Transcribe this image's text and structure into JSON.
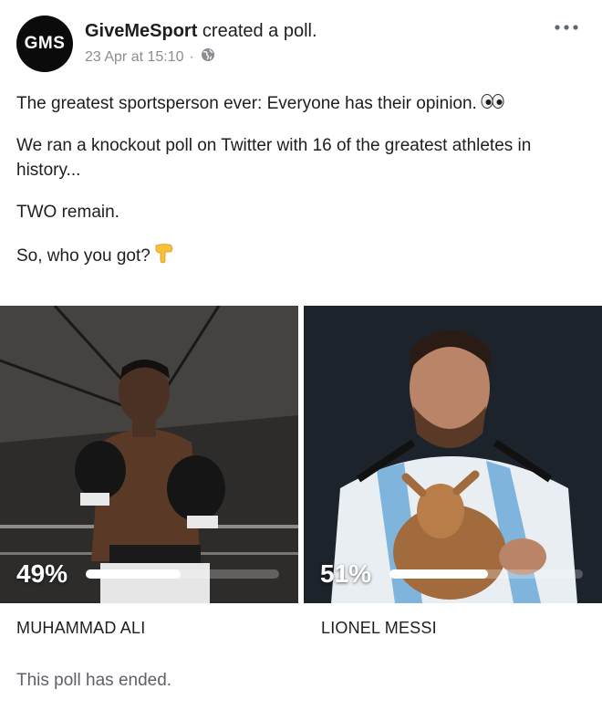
{
  "post": {
    "avatar_text": "GMS",
    "author": "GiveMeSport",
    "action": " created a poll.",
    "timestamp": "23 Apr at 15:10",
    "privacy_icon": "globe-icon",
    "more_icon": "more-options-icon"
  },
  "caption": {
    "line1": "The greatest sportsperson ever: Everyone has their opinion.",
    "line1_emoji": "eyes-emoji",
    "line2": "We ran a knockout poll on Twitter with 16 of the greatest athletes in history...",
    "line3": "TWO remain.",
    "line4": "So, who you got?",
    "line4_emoji": "pointing-down-emoji"
  },
  "poll": {
    "options": [
      {
        "name": "MUHAMMAD ALI",
        "percent_label": "49%",
        "percent": 49
      },
      {
        "name": "LIONEL MESSI",
        "percent_label": "51%",
        "percent": 51
      }
    ],
    "status": "This poll has ended."
  },
  "colors": {
    "text": "#1c1e21",
    "meta": "#8a8d91",
    "avatar_bg": "#0b0b0b",
    "bar": "#ffffff"
  }
}
